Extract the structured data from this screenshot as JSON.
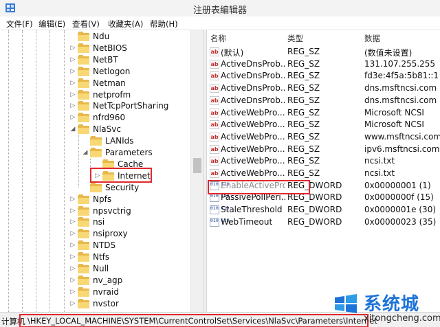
{
  "window": {
    "title": "注册表编辑器"
  },
  "menu": [
    "文件(F)",
    "编辑(E)",
    "查看(V)",
    "收藏夹(A)",
    "帮助(H)"
  ],
  "tree": {
    "nodes": [
      {
        "label": "Ndu"
      },
      {
        "label": "NetBIOS"
      },
      {
        "label": "NetBT"
      },
      {
        "label": "Netlogon"
      },
      {
        "label": "Netman"
      },
      {
        "label": "netprofm"
      },
      {
        "label": "NetTcpPortSharing"
      },
      {
        "label": "nfrd960"
      },
      {
        "label": "NlaSvc",
        "expanded": true
      },
      {
        "label": "LANIds"
      },
      {
        "label": "Parameters",
        "expanded": true
      },
      {
        "label": "Cache"
      },
      {
        "label": "Internet",
        "selected": true
      },
      {
        "label": "Security"
      },
      {
        "label": "Npfs"
      },
      {
        "label": "npsvctrig"
      },
      {
        "label": "nsi"
      },
      {
        "label": "nsiproxy"
      },
      {
        "label": "NTDS"
      },
      {
        "label": "Ntfs"
      },
      {
        "label": "Null"
      },
      {
        "label": "nv_agp"
      },
      {
        "label": "nvraid"
      },
      {
        "label": "nvstor"
      }
    ]
  },
  "list": {
    "headers": {
      "name": "名称",
      "type": "类型",
      "data": "数据"
    },
    "rows": [
      {
        "icon": "string-value-icon",
        "name": "(默认)",
        "type": "REG_SZ",
        "data": "(数值未设置)"
      },
      {
        "icon": "string-value-icon",
        "name": "ActiveDnsProb...",
        "type": "REG_SZ",
        "data": "131.107.255.255"
      },
      {
        "icon": "string-value-icon",
        "name": "ActiveDnsProb...",
        "type": "REG_SZ",
        "data": "fd3e:4f5a:5b81::1"
      },
      {
        "icon": "string-value-icon",
        "name": "ActiveDnsProb...",
        "type": "REG_SZ",
        "data": "dns.msftncsi.com"
      },
      {
        "icon": "string-value-icon",
        "name": "ActiveDnsProb...",
        "type": "REG_SZ",
        "data": "dns.msftncsi.com"
      },
      {
        "icon": "string-value-icon",
        "name": "ActiveWebPro...",
        "type": "REG_SZ",
        "data": "Microsoft NCSI"
      },
      {
        "icon": "string-value-icon",
        "name": "ActiveWebPro...",
        "type": "REG_SZ",
        "data": "Microsoft NCSI"
      },
      {
        "icon": "string-value-icon",
        "name": "ActiveWebPro...",
        "type": "REG_SZ",
        "data": "www.msftncsi.com"
      },
      {
        "icon": "string-value-icon",
        "name": "ActiveWebPro...",
        "type": "REG_SZ",
        "data": "ipv6.msftncsi.com"
      },
      {
        "icon": "string-value-icon",
        "name": "ActiveWebPro...",
        "type": "REG_SZ",
        "data": "ncsi.txt"
      },
      {
        "icon": "string-value-icon",
        "name": "ActiveWebPro...",
        "type": "REG_SZ",
        "data": "ncsi.txt"
      },
      {
        "icon": "binary-value-icon",
        "name": "EnableActiveProbing",
        "type": "REG_DWORD",
        "data": "0x00000001 (1)",
        "highlighted": true
      },
      {
        "icon": "binary-value-icon",
        "name": "PassivePollPeri...",
        "type": "REG_DWORD",
        "data": "0x0000000f (15)"
      },
      {
        "icon": "binary-value-icon",
        "name": "StaleThreshold",
        "type": "REG_DWORD",
        "data": "0x0000001e (30)"
      },
      {
        "icon": "binary-value-icon",
        "name": "WebTimeout",
        "type": "REG_DWORD",
        "data": "0x00000023 (35)"
      }
    ]
  },
  "status": {
    "prefix": "计算机",
    "path": "\\HKEY_LOCAL_MACHINE\\SYSTEM\\CurrentControlSet\\Services\\NlaSvc\\Parameters\\Internet"
  },
  "watermark": {
    "title": "系统城",
    "url": "xitongcheng.com"
  },
  "colors": {
    "highlight": "#e0282d",
    "folder": "#f8d775",
    "watermark": "#1e73d8"
  }
}
